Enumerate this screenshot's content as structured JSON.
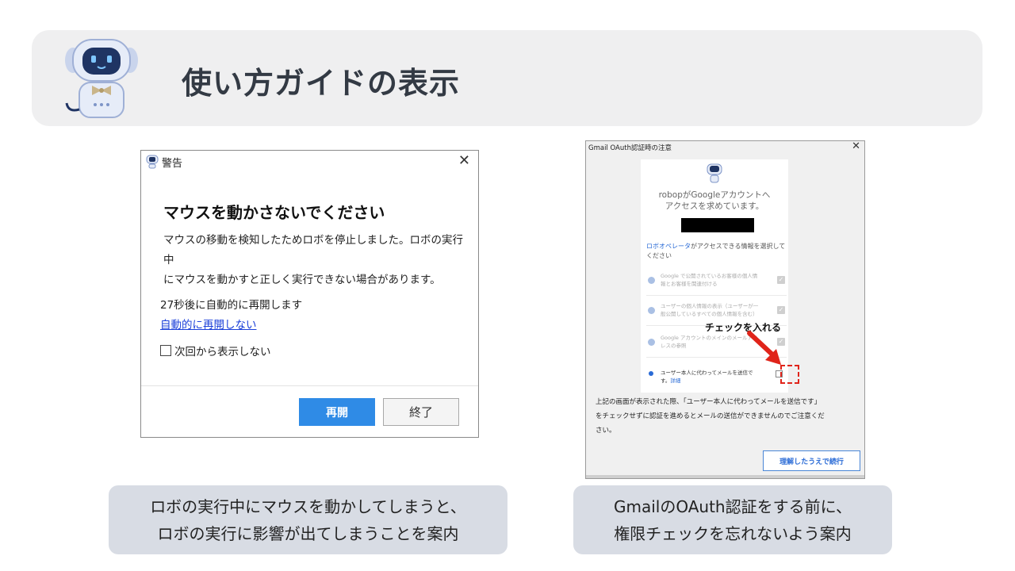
{
  "header": {
    "title": "使い方ガイドの表示",
    "mascot_icon": "robot-mascot-icon"
  },
  "warning_dialog": {
    "window_title": "警告",
    "close_glyph": "✕",
    "heading": "マウスを動かさないでください",
    "message_line1": "マウスの移動を検知したためロボを停止しました。ロボの実行中",
    "message_line2": "にマウスを動かすと正しく実行できない場合があります。",
    "countdown": "27秒後に自動的に再開します",
    "no_auto_resume_link": "自動的に再開しない",
    "dont_show_again": "次回から表示しない",
    "resume_button": "再開",
    "end_button": "終了",
    "accent_color": "#2f8be6"
  },
  "oauth_dialog": {
    "window_title": "Gmail OAuth認証時の注意",
    "close_glyph": "✕",
    "card_heading_line1": "robopがGoogleアカウントへ",
    "card_heading_line2": "アクセスを求めています。",
    "select_prefix": "ロボオペレータ",
    "select_suffix": "がアクセスできる情報を選択して",
    "select_line2": "ください",
    "permissions": [
      {
        "line1": "Google で公開されているお客様の個人情",
        "line2": "報とお客様を関連付ける"
      },
      {
        "line1": "ユーザーの個人情報の表示（ユーザーが一",
        "line2": "般公開しているすべての個人情報を含む）"
      },
      {
        "line1": "Google アカウントのメインのメールアド",
        "line2": "レスの参照"
      }
    ],
    "send_permission_line1": "ユーザー本人に代わってメールを送信で",
    "send_permission_line2_prefix": "す。",
    "send_permission_detail": "詳細",
    "check_mark": "✓",
    "annotation": "チェックを入れる",
    "notice_line1": "上記の画面が表示された際、「ユーザー本人に代わってメールを送信です」",
    "notice_line2": "をチェックせずに認証を進めるとメールの送信ができませんのでご注意くだ",
    "notice_line3": "さい。",
    "continue_button": "理解したうえで続行",
    "annotation_color": "#e0241a"
  },
  "captions": {
    "left_line1": "ロボの実行中にマウスを動かしてしまうと、",
    "left_line2": "ロボの実行に影響が出てしまうことを案内",
    "right_line1": "GmailのOAuth認証をする前に、",
    "right_line2": "権限チェックを忘れないよう案内"
  }
}
